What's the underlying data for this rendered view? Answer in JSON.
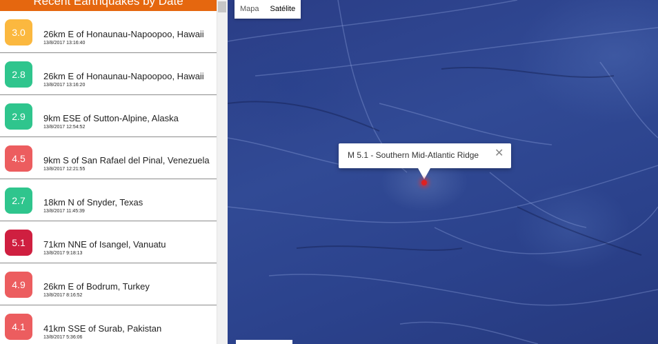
{
  "sidebar": {
    "header": "Recent Earthquakes by Date",
    "items": [
      {
        "mag": "3.0",
        "place": "26km E of Honaunau-Napoopoo, Hawaii",
        "time": "13/8/2017 13:16:40",
        "color": "#fbb83f"
      },
      {
        "mag": "2.8",
        "place": "26km E of Honaunau-Napoopoo, Hawaii",
        "time": "13/8/2017 13:16:20",
        "color": "#2fc58d"
      },
      {
        "mag": "2.9",
        "place": "9km ESE of Sutton-Alpine, Alaska",
        "time": "13/8/2017 12:54:52",
        "color": "#2fc58d"
      },
      {
        "mag": "4.5",
        "place": "9km S of San Rafael del Pinal, Venezuela",
        "time": "13/8/2017 12:21:55",
        "color": "#ec5d5f"
      },
      {
        "mag": "2.7",
        "place": "18km N of Snyder, Texas",
        "time": "13/8/2017 11:45:39",
        "color": "#2fc58d"
      },
      {
        "mag": "5.1",
        "place": "71km NNE of Isangel, Vanuatu",
        "time": "13/8/2017 9:18:13",
        "color": "#cf1f40"
      },
      {
        "mag": "4.9",
        "place": "26km E of Bodrum, Turkey",
        "time": "13/8/2017 8:16:52",
        "color": "#ec5d5f"
      },
      {
        "mag": "4.1",
        "place": "41km SSE of Surab, Pakistan",
        "time": "13/8/2017 5:36:06",
        "color": "#ec5d5f"
      }
    ]
  },
  "map": {
    "type_buttons": {
      "map": "Mapa",
      "satellite": "Satélite"
    },
    "active_type": "satellite",
    "popup": {
      "text": "M 5.1 - Southern Mid-Atlantic Ridge",
      "close_glyph": "✕"
    },
    "marker_color": "#e02020"
  }
}
